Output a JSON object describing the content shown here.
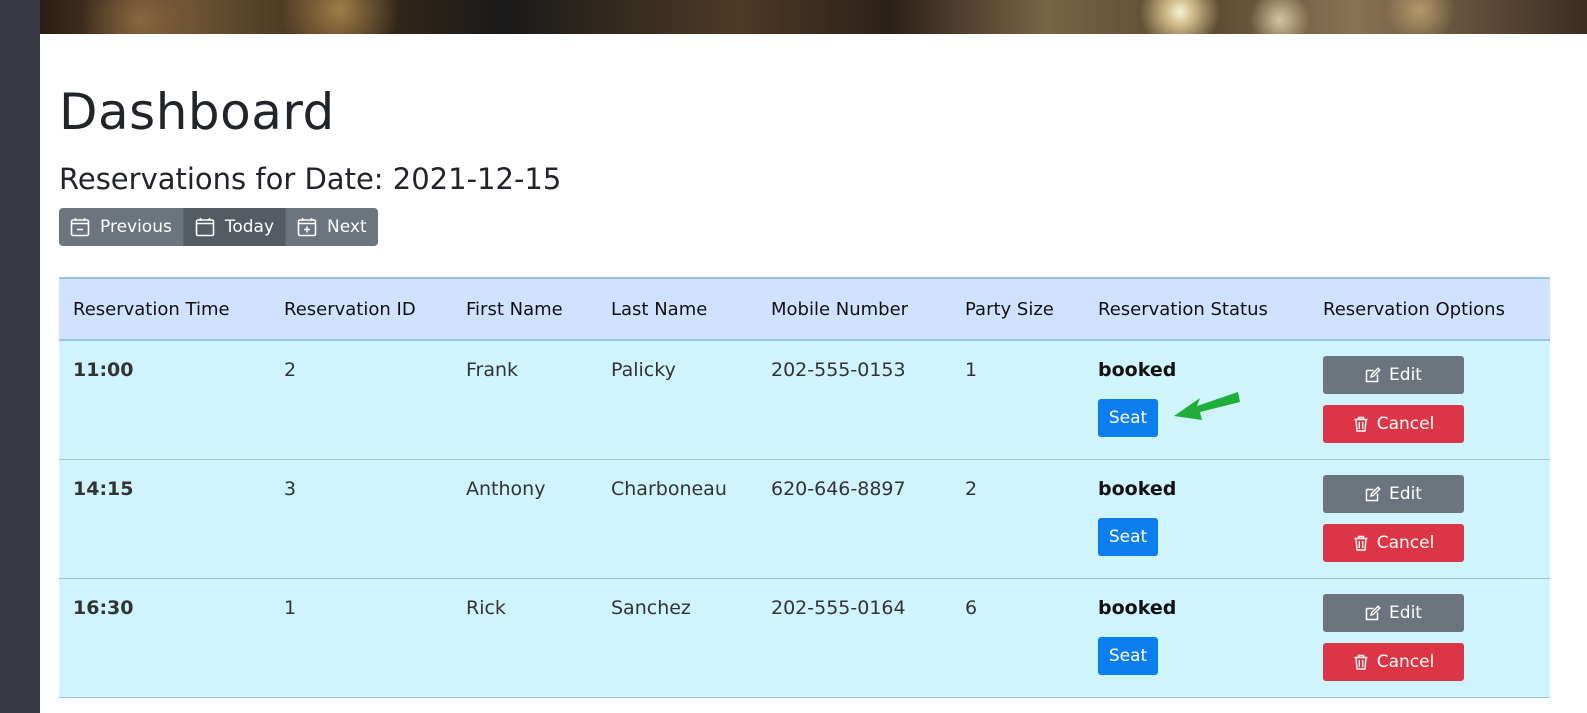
{
  "page": {
    "title": "Dashboard",
    "subtitle": "Reservations for Date: 2021-12-15"
  },
  "date_nav": {
    "previous_label": "Previous",
    "today_label": "Today",
    "next_label": "Next"
  },
  "table": {
    "headers": [
      "Reservation Time",
      "Reservation ID",
      "First Name",
      "Last Name",
      "Mobile Number",
      "Party Size",
      "Reservation Status",
      "Reservation Options"
    ],
    "rows": [
      {
        "time": "11:00",
        "id": "2",
        "first_name": "Frank",
        "last_name": "Palicky",
        "mobile": "202-555-0153",
        "party_size": "1",
        "status": "booked",
        "seat_label": "Seat",
        "edit_label": "Edit",
        "cancel_label": "Cancel"
      },
      {
        "time": "14:15",
        "id": "3",
        "first_name": "Anthony",
        "last_name": "Charboneau",
        "mobile": "620-646-8897",
        "party_size": "2",
        "status": "booked",
        "seat_label": "Seat",
        "edit_label": "Edit",
        "cancel_label": "Cancel"
      },
      {
        "time": "16:30",
        "id": "1",
        "first_name": "Rick",
        "last_name": "Sanchez",
        "mobile": "202-555-0164",
        "party_size": "6",
        "status": "booked",
        "seat_label": "Seat",
        "edit_label": "Edit",
        "cancel_label": "Cancel"
      }
    ]
  },
  "icons": {
    "previous": "calendar-minus-icon",
    "today": "calendar-icon",
    "next": "calendar-plus-icon",
    "edit": "pencil-square-icon",
    "cancel": "trash-icon",
    "annotation": "green-arrow-icon"
  },
  "colors": {
    "sidebar": "#373a44",
    "secondary_button": "#6c757d",
    "primary_button": "#0d7ef0",
    "danger_button": "#dc3545",
    "table_header_bg": "#cfe2ff",
    "table_row_bg": "#cff4fc",
    "annotation_arrow": "#1fae3a"
  }
}
